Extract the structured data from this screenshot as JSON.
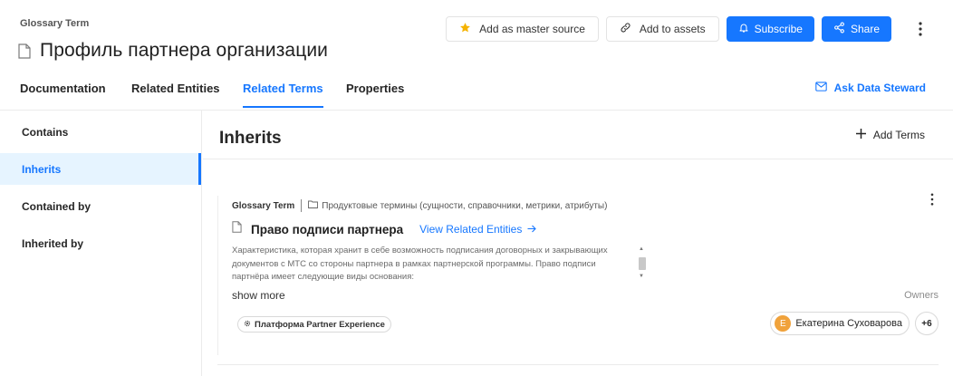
{
  "header": {
    "eyebrow": "Glossary Term",
    "title": "Профиль партнера организации",
    "icon": "document-icon"
  },
  "actions": {
    "master_source": "Add as master source",
    "add_to_assets": "Add to assets",
    "subscribe": "Subscribe",
    "share": "Share"
  },
  "tabs": [
    {
      "label": "Documentation"
    },
    {
      "label": "Related Entities"
    },
    {
      "label": "Related Terms",
      "active": true
    },
    {
      "label": "Properties"
    }
  ],
  "ask_steward": "Ask Data Steward",
  "sidebar": {
    "items": [
      {
        "label": "Contains"
      },
      {
        "label": "Inherits",
        "active": true
      },
      {
        "label": "Contained by"
      },
      {
        "label": "Inherited by"
      }
    ]
  },
  "main": {
    "section_title": "Inherits",
    "add_terms": "Add Terms"
  },
  "card": {
    "type": "Glossary Term",
    "path": "Продуктовые термины (сущности, справочники, метрики, атрибуты)",
    "term_name": "Право подписи партнера",
    "view_related": "View Related Entities",
    "description": "Характеристика, которая хранит в себе возможность подписания договорных и закрывающих документов с МТС со стороны партнера в рамках партнерской программы. Право подписи партнёра имеет следующие виды основания:",
    "show_more": "show more",
    "owners_label": "Owners",
    "tag": "Платформа Partner Experience",
    "owner_initial": "E",
    "owner_name": "Екатерина Суховарова",
    "more_owners": "+6"
  },
  "colors": {
    "accent": "#1677ff",
    "active_bg": "#e6f4ff",
    "star": "#f5b301",
    "avatar": "#f0a23b"
  }
}
